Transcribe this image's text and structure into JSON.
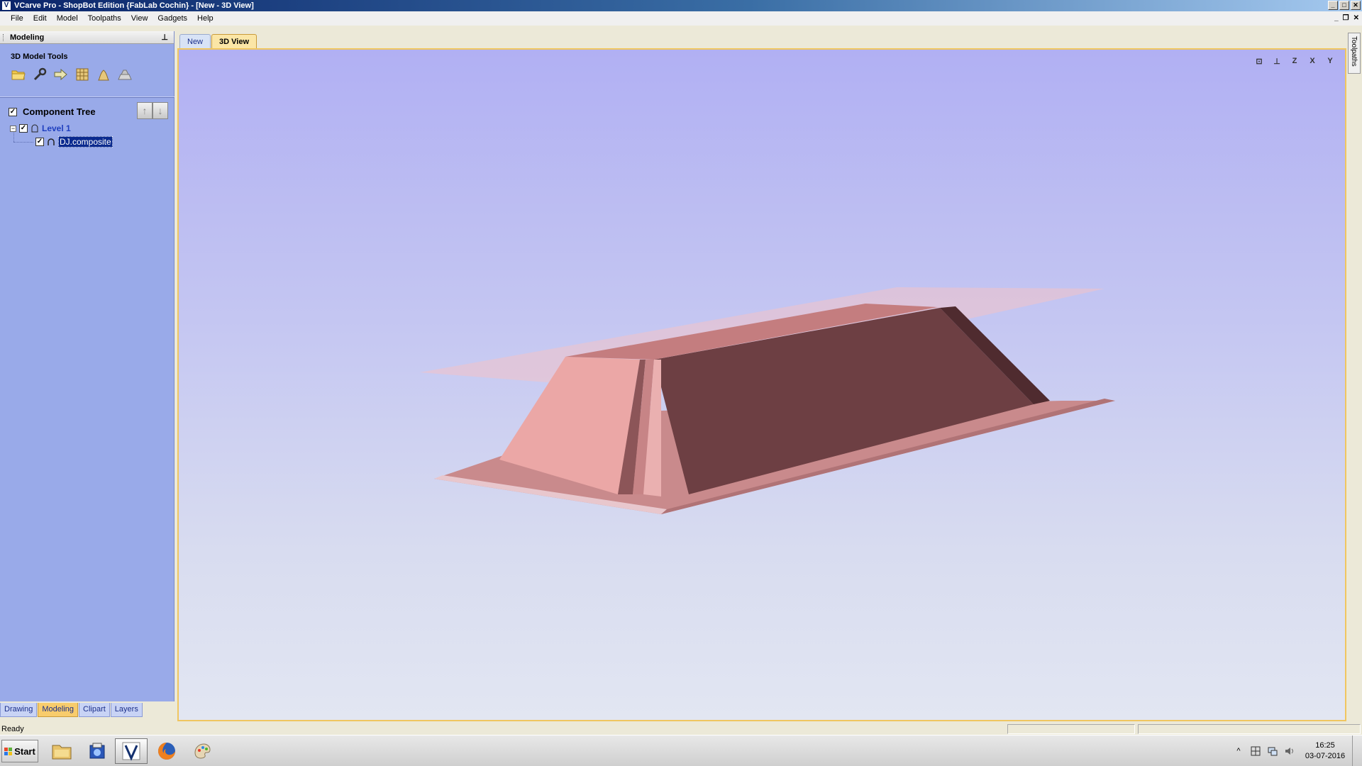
{
  "window": {
    "title": "VCarve Pro - ShopBot Edition {FabLab Cochin} - [New - 3D View]",
    "controls": {
      "minimize": "_",
      "maximize": "□",
      "close": "✕"
    },
    "mdi_controls": {
      "minimize": "_",
      "restore": "❐",
      "close": "✕"
    }
  },
  "menu": [
    "File",
    "Edit",
    "Model",
    "Toolpaths",
    "View",
    "Gadgets",
    "Help"
  ],
  "panel": {
    "title": "Modeling",
    "pin": "⊥",
    "tools_title": "3D Model Tools",
    "tools": [
      "open-folder-icon",
      "wrench-icon",
      "arrow-shape-icon",
      "grid-icon",
      "bell-shape-icon",
      "dome-icon"
    ],
    "tree": {
      "header": "Component Tree",
      "checked": true,
      "move_up": "↑",
      "move_down": "↓",
      "level": {
        "label": "Level 1",
        "expander": "−",
        "checked": true
      },
      "component": {
        "label": "DJ.composite",
        "checked": true
      }
    },
    "tabs": [
      {
        "label": "Drawing",
        "active": false
      },
      {
        "label": "Modeling",
        "active": true
      },
      {
        "label": "Clipart",
        "active": false
      },
      {
        "label": "Layers",
        "active": false
      }
    ]
  },
  "doc_tabs": [
    {
      "label": "New",
      "active": false
    },
    {
      "label": "3D View",
      "active": true
    }
  ],
  "view_tools": [
    {
      "name": "zoom-extents-icon",
      "label": "⊡"
    },
    {
      "name": "iso-view-icon",
      "label": "⊥"
    },
    {
      "name": "view-z-icon",
      "label": "Z"
    },
    {
      "name": "view-x-icon",
      "label": "X"
    },
    {
      "name": "view-y-icon",
      "label": "Y"
    }
  ],
  "side_tab": "Toolpaths",
  "status": {
    "text": "Ready"
  },
  "taskbar": {
    "start_label": "Start",
    "apps": [
      "file-explorer-icon",
      "vectric-setup-icon",
      "vcarve-icon",
      "firefox-icon",
      "paint-icon"
    ],
    "clock_time": "16:25",
    "clock_date": "03-07-2016",
    "tray_arrow": "^"
  },
  "colors": {
    "panel_bg": "#99aae9",
    "viewport_top": "#b1b0f3",
    "viewport_bottom": "#e2e6f2",
    "model_light": "#eba7a6",
    "model_dark": "#6d3f43",
    "active_tab": "#f8cc6c"
  }
}
